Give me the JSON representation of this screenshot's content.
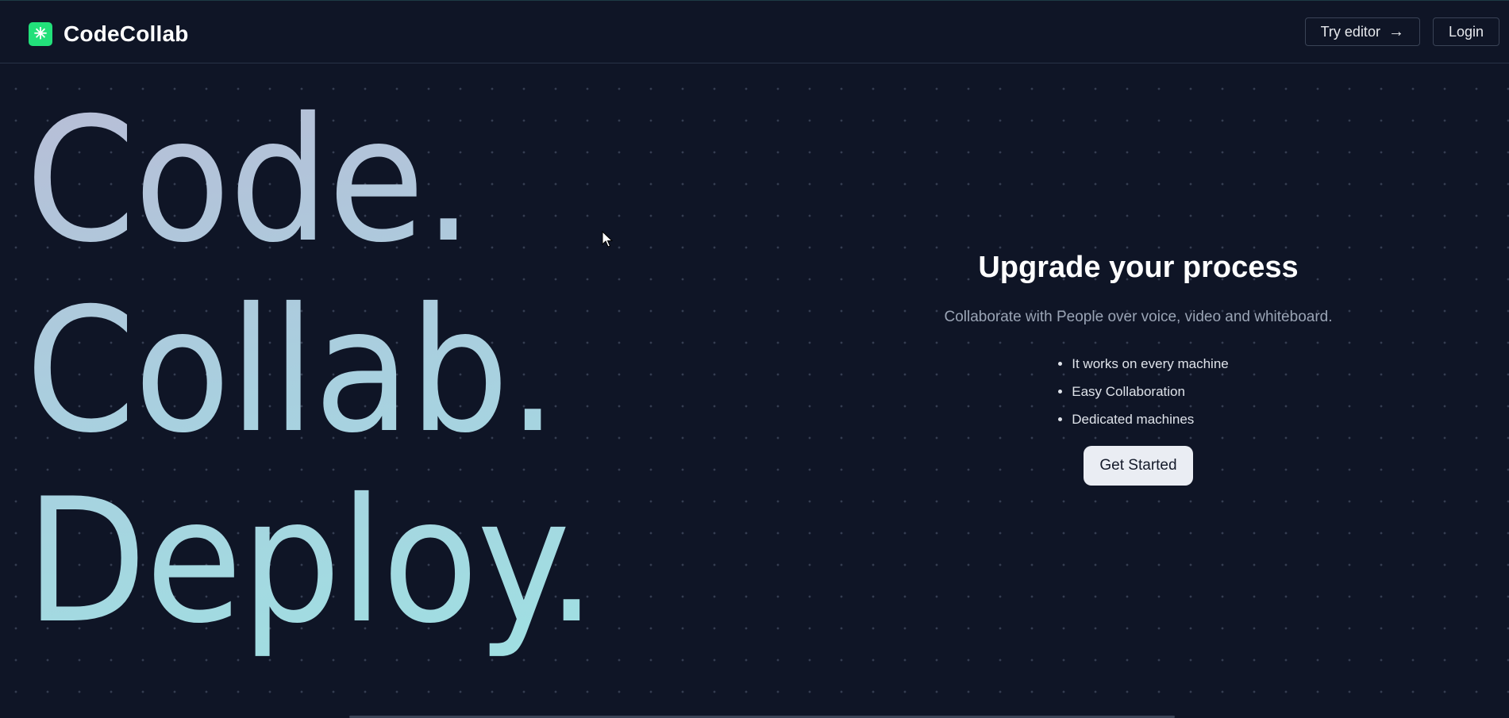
{
  "header": {
    "brand_name": "CodeCollab",
    "logo_icon": "asterisk-spark-icon",
    "try_editor_label": "Try editor",
    "try_editor_icon": "arrow-right-icon",
    "login_label": "Login"
  },
  "hero": {
    "words": [
      "Code.",
      "Collab.",
      "Deploy."
    ]
  },
  "panel": {
    "title": "Upgrade your process",
    "subtitle": "Collaborate with People over voice, video and whiteboard.",
    "features": [
      "It works on every machine",
      "Easy Collaboration",
      "Dedicated machines"
    ],
    "cta_label": "Get Started"
  },
  "colors": {
    "background": "#0f1526",
    "logo_accent": "#22e07a",
    "gradient_start": "#b8bdd6",
    "gradient_end": "#9fe0e2",
    "cta_background": "#eaedf3"
  }
}
